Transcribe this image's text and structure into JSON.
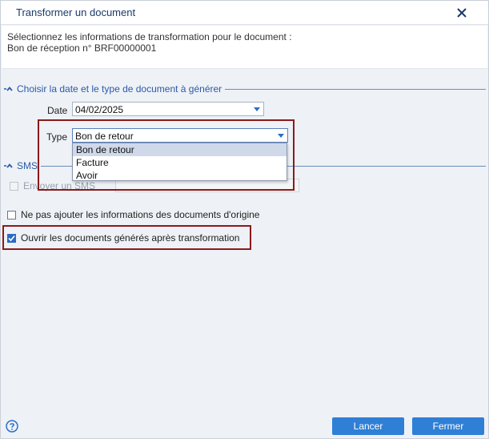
{
  "dialog": {
    "title": "Transformer un document"
  },
  "info": {
    "line1": "Sélectionnez les informations de transformation pour le document :",
    "line2": "Bon de réception n° BRF00000001"
  },
  "section_date_type": {
    "title": "Choisir la date et le type de document à générer",
    "date_label": "Date",
    "date_value": "04/02/2025",
    "type_label": "Type",
    "type_value": "Bon de retour",
    "type_options": [
      "Bon de retour",
      "Facture",
      "Avoir"
    ]
  },
  "section_sms": {
    "title": "SMS",
    "send_sms_label": "Envoyer un SMS"
  },
  "options": {
    "no_origin_info_label": "Ne pas ajouter les informations des documents d'origine",
    "open_generated_label": "Ouvrir les documents générés après transformation"
  },
  "footer": {
    "cancel_label": "Lancer",
    "close_label": "Fermer"
  },
  "colors": {
    "accent": "#2f7fd6",
    "highlight": "#8b1a1a",
    "section_title": "#2a5aa8"
  }
}
